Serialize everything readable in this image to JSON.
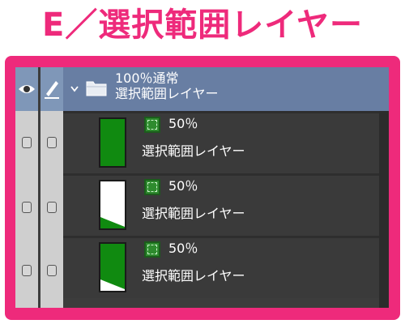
{
  "heading": "E／選択範囲レイヤー",
  "colors": {
    "accent": "#ee2a7b",
    "folder_row": "#687ea3",
    "panel": "#3c3c3c",
    "layer_fill": "#108a10"
  },
  "icons": {
    "visibility": "eye-icon",
    "lock_edit": "pen-icon",
    "expand": "chevron-down-icon",
    "folder": "folder-icon",
    "selection_layer": "selection-layer-icon"
  },
  "folder": {
    "opacity_blend": "100％通常",
    "name": "選択範囲レイヤー"
  },
  "layers": [
    {
      "opacity": "50％",
      "name": "選択範囲レイヤー",
      "thumb": "full"
    },
    {
      "opacity": "50％",
      "name": "選択範囲レイヤー",
      "thumb": "corner"
    },
    {
      "opacity": "50％",
      "name": "選択範囲レイヤー",
      "thumb": "most"
    }
  ]
}
